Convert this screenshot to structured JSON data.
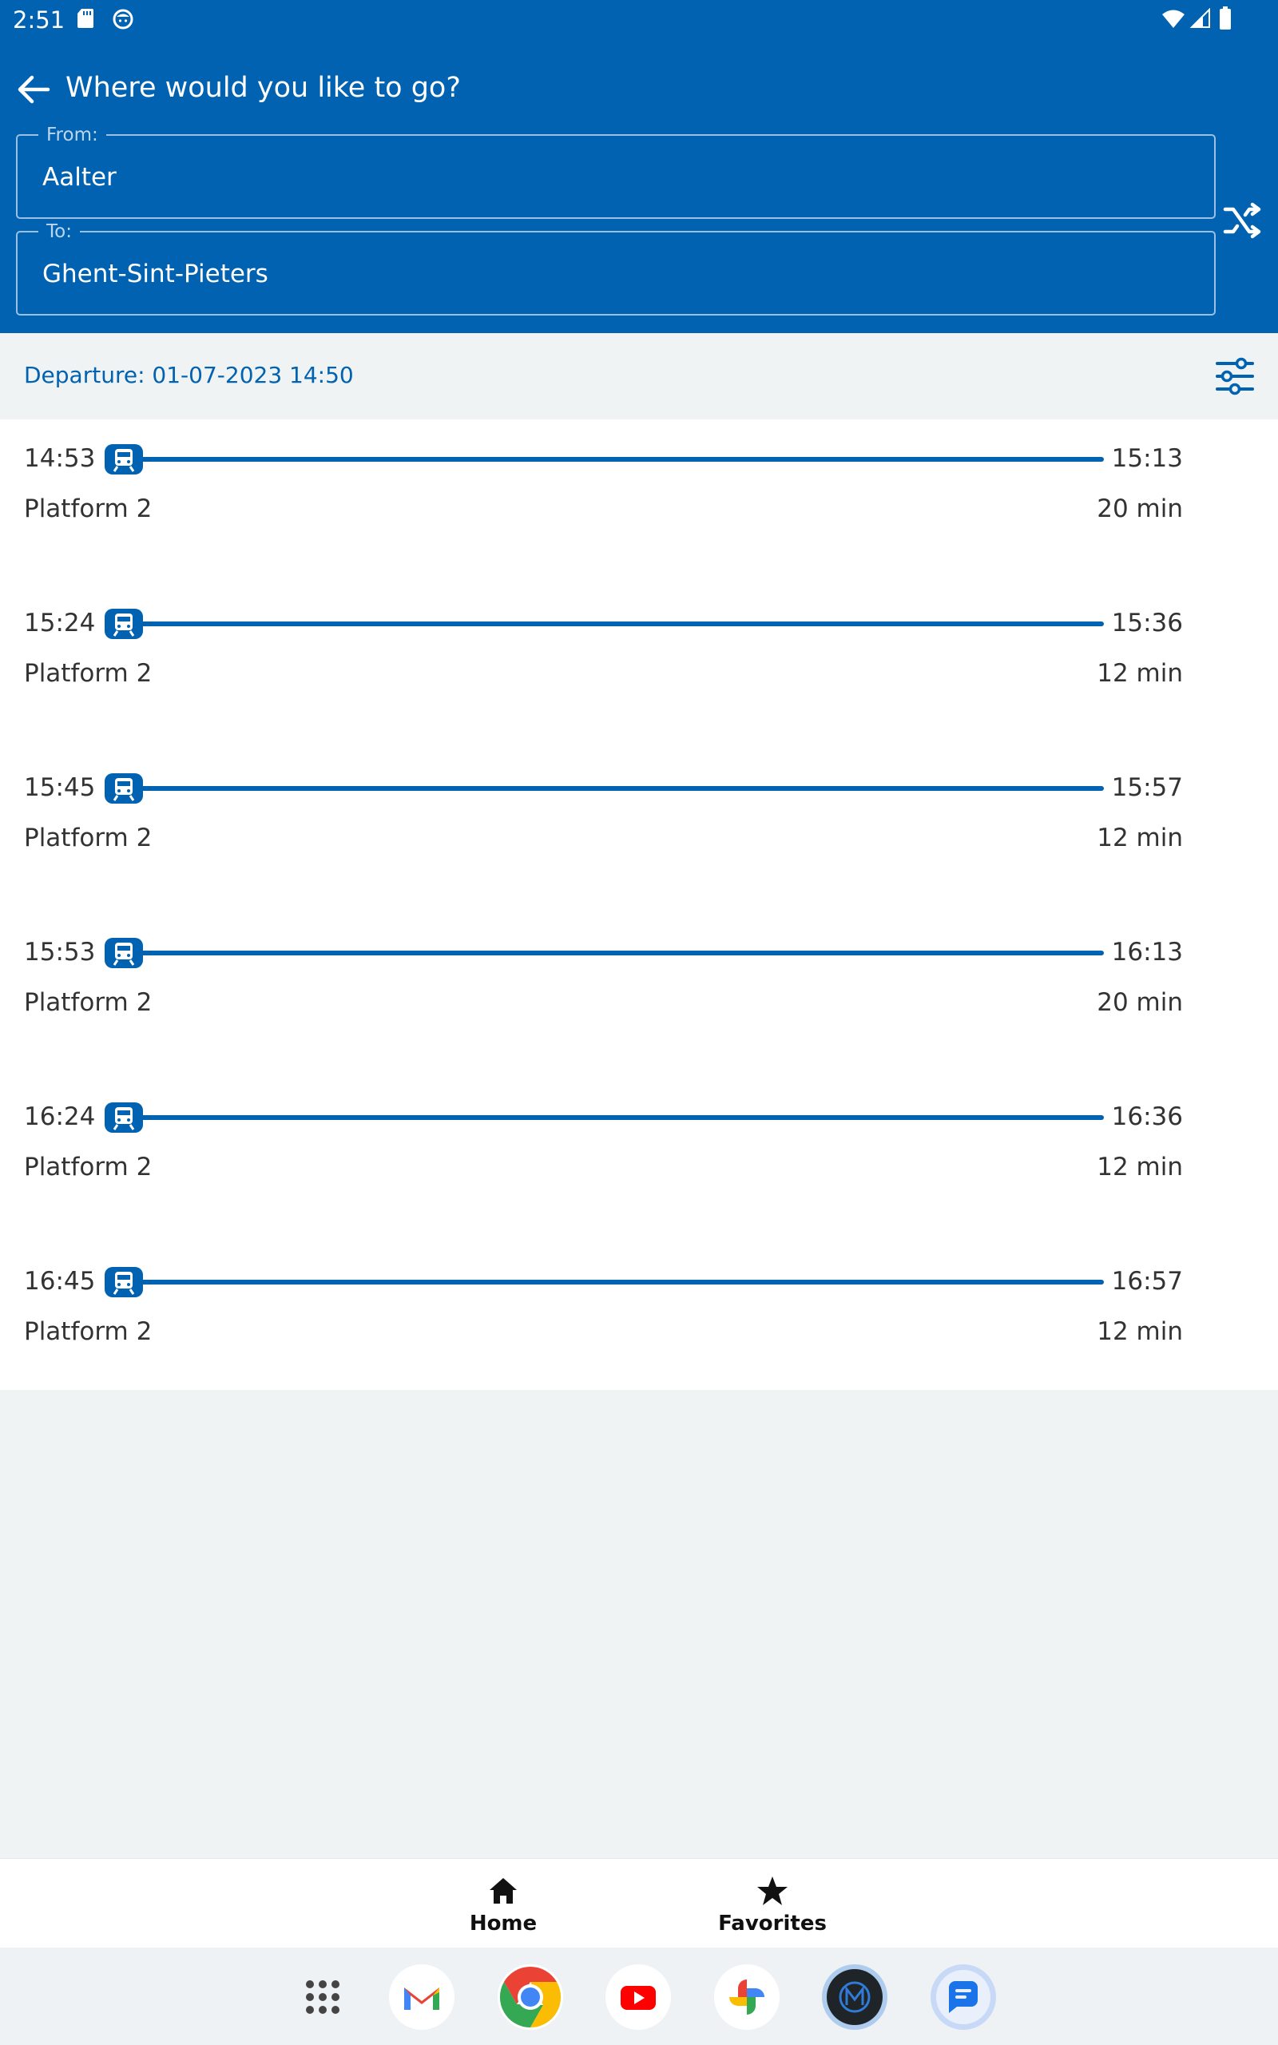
{
  "status_bar": {
    "time": "2:51"
  },
  "header": {
    "title": "Where would you like to go?",
    "from_label": "From:",
    "from_value": "Aalter",
    "to_label": "To:",
    "to_value": "Ghent-Sint-Pieters"
  },
  "departure": {
    "text": "Departure: 01-07-2023 14:50"
  },
  "trips": [
    {
      "dep": "14:53",
      "arr": "15:13",
      "platform": "Platform 2",
      "duration": "20 min"
    },
    {
      "dep": "15:24",
      "arr": "15:36",
      "platform": "Platform 2",
      "duration": "12 min"
    },
    {
      "dep": "15:45",
      "arr": "15:57",
      "platform": "Platform 2",
      "duration": "12 min"
    },
    {
      "dep": "15:53",
      "arr": "16:13",
      "platform": "Platform 2",
      "duration": "20 min"
    },
    {
      "dep": "16:24",
      "arr": "16:36",
      "platform": "Platform 2",
      "duration": "12 min"
    },
    {
      "dep": "16:45",
      "arr": "16:57",
      "platform": "Platform 2",
      "duration": "12 min"
    }
  ],
  "bottom_nav": {
    "home_label": "Home",
    "favorites_label": "Favorites"
  },
  "dock": {
    "apps": [
      "app-drawer-icon",
      "gmail-icon",
      "chrome-icon",
      "youtube-icon",
      "photos-icon",
      "metro-app-icon",
      "messages-icon"
    ]
  },
  "colors": {
    "primary": "#0062b0",
    "background": "#eff3f3"
  }
}
